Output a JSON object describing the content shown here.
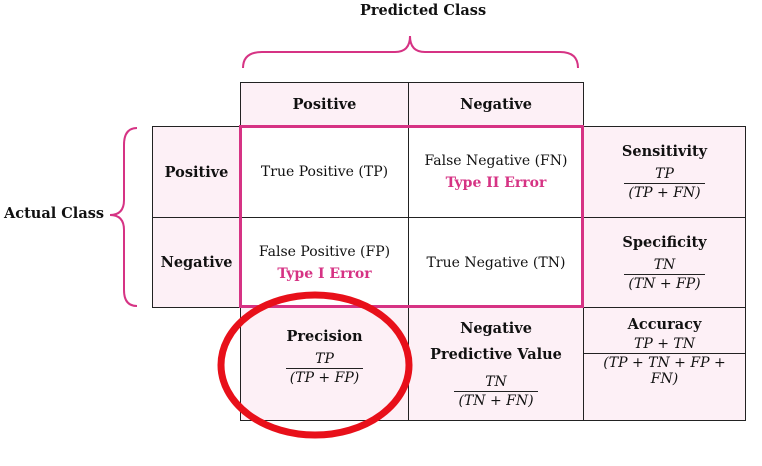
{
  "predicted_label": "Predicted Class",
  "actual_label": "Actual Class",
  "col_headers": [
    "Positive",
    "Negative"
  ],
  "row_headers": [
    "Positive",
    "Negative"
  ],
  "cells": {
    "tp": "True Positive (TP)",
    "fn": "False Negative (FN)",
    "fn_error": "Type II Error",
    "fp": "False Positive (FP)",
    "fp_error": "Type I Error",
    "tn": "True Negative (TN)"
  },
  "metrics": {
    "sensitivity": {
      "title": "Sensitivity",
      "num": "TP",
      "den": "(TP + FN)"
    },
    "specificity": {
      "title": "Specificity",
      "num": "TN",
      "den": "(TN + FP)"
    },
    "precision": {
      "title": "Precision",
      "num": "TP",
      "den": "(TP + FP)"
    },
    "npv": {
      "title": "Negative Predictive Value",
      "num": "TN",
      "den": "(TN + FN)"
    },
    "accuracy": {
      "title": "Accuracy",
      "num": "TP + TN",
      "den": "(TP + TN + FP + FN)"
    }
  },
  "colors": {
    "accent": "#d63384",
    "cell_fill": "#fdf0f6",
    "highlight": "#e8101a"
  }
}
